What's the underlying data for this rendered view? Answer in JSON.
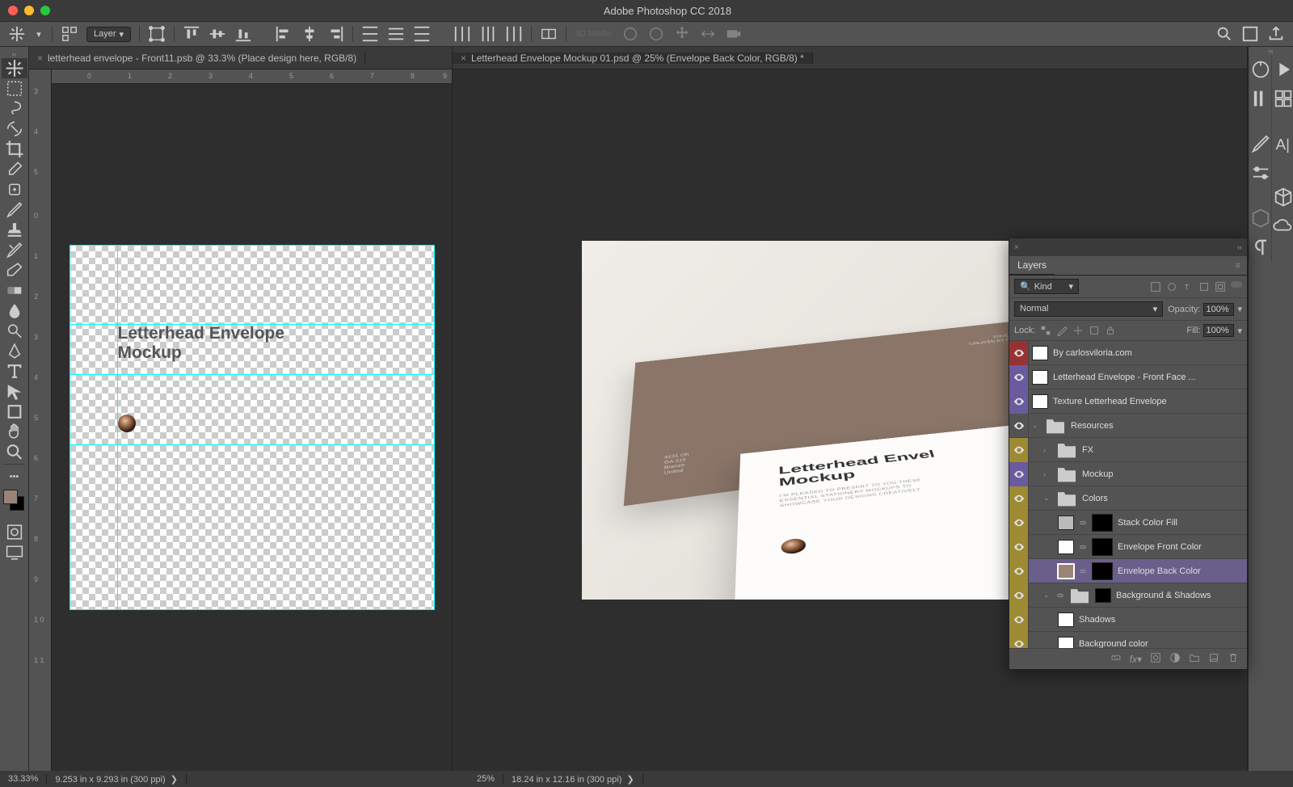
{
  "app_title": "Adobe Photoshop CC 2018",
  "options": {
    "layer_select": "Layer",
    "mode_3d": "3D Mode:"
  },
  "tabs": [
    {
      "label": "letterhead envelope - Front11.psb @ 33.3% (Place design here, RGB/8)",
      "active": false
    },
    {
      "label": "Letterhead Envelope Mockup 01.psd @ 25% (Envelope Back Color, RGB/8) *",
      "active": true
    }
  ],
  "left_canvas": {
    "title_l1": "Letterhead Envelope",
    "title_l2": "Mockup",
    "ruler_h": [
      "0",
      "1",
      "2",
      "3",
      "4",
      "5",
      "6",
      "7",
      "8",
      "9"
    ],
    "ruler_v": [
      "3",
      "4",
      "5",
      "6",
      "0",
      "1",
      "2",
      "3",
      "4",
      "5",
      "6",
      "7",
      "8",
      "9",
      "1 0",
      "1 1"
    ]
  },
  "right_canvas": {
    "env_brand_l1": "ENVELOPE MOCKUP",
    "env_brand_l2": "CREATED BY CARLOS VILORIA",
    "lh_title_l1": "Letterhead Envel",
    "lh_title_l2": "Mockup",
    "lh_sub_l1": "I'M PLEASED TO PRESENT TO YOU THESE",
    "lh_sub_l2": "ESSENTIAL STATIONERY MOCKUPS TO",
    "lh_sub_l3": "SHOWCASE YOUR DESIGNS CREATIVELY"
  },
  "layers_panel": {
    "title": "Layers",
    "filter_kind": "Kind",
    "blend_mode": "Normal",
    "opacity_label": "Opacity:",
    "opacity_value": "100%",
    "lock_label": "Lock:",
    "fill_label": "Fill:",
    "fill_value": "100%",
    "layers": [
      {
        "name": "By carlosviloria.com",
        "vis": "red",
        "indent": 0,
        "thumb": "white"
      },
      {
        "name": "Letterhead Envelope - Front Face ...",
        "vis": "purple",
        "indent": 0,
        "thumb": "smart"
      },
      {
        "name": "Texture Letterhead Envelope",
        "vis": "purple",
        "indent": 0,
        "thumb": "smart"
      },
      {
        "name": "Resources",
        "vis": "none",
        "indent": 0,
        "folder": true,
        "open": true
      },
      {
        "name": "FX",
        "vis": "yellow",
        "indent": 1,
        "folder": true,
        "open": false
      },
      {
        "name": "Mockup",
        "vis": "purple",
        "indent": 1,
        "folder": true,
        "open": false
      },
      {
        "name": "Colors",
        "vis": "yellow",
        "indent": 1,
        "folder": true,
        "open": true
      },
      {
        "name": "Stack Color Fill",
        "vis": "yellow",
        "indent": 2,
        "thumb": "fill",
        "mask": true,
        "link": true
      },
      {
        "name": "Envelope Front Color",
        "vis": "yellow",
        "indent": 2,
        "thumb": "white",
        "mask": true,
        "link": true
      },
      {
        "name": "Envelope Back Color",
        "vis": "yellow",
        "indent": 2,
        "thumb": "back",
        "mask": true,
        "link": true,
        "selected": true
      },
      {
        "name": "Background & Shadows",
        "vis": "yellow",
        "indent": 1,
        "folder": true,
        "open": true,
        "mask": true,
        "link": true
      },
      {
        "name": "Shadows",
        "vis": "yellow",
        "indent": 2,
        "thumb": "white"
      },
      {
        "name": "Background color",
        "vis": "yellow",
        "indent": 2,
        "thumb": "white"
      }
    ]
  },
  "status": {
    "left_zoom": "33.33%",
    "left_info": "9.253 in x 9.293 in (300 ppi)",
    "right_zoom": "25%",
    "right_info": "18.24 in x 12.16 in (300 ppi)"
  }
}
